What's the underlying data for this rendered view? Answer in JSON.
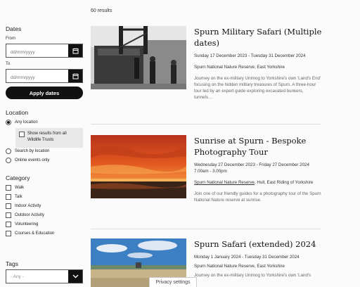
{
  "results_count": "60 results",
  "filters": {
    "dates": {
      "title": "Dates",
      "from_label": "From",
      "from_placeholder": "dd/mm/yyyy",
      "to_label": "To",
      "to_placeholder": "dd/mm/yyyy",
      "apply_label": "Apply dates"
    },
    "location": {
      "title": "Location",
      "options": [
        "Any location",
        "Search by location",
        "Online events only"
      ],
      "selected": "Any location",
      "show_all_label": "Show results from all Wildlife Trusts"
    },
    "category": {
      "title": "Category",
      "options": [
        "Walk",
        "Talk",
        "Indoor Activity",
        "Outdoor Activity",
        "Volunteering",
        "Courses & Education"
      ]
    },
    "tags": {
      "title": "Tags",
      "value": "- Any -"
    }
  },
  "results": [
    {
      "title": "Spurn Military Safari (Multiple dates)",
      "date": "Sunday 17 December 2023 - Tuesday 31 December 2024",
      "time": "",
      "location_link": "",
      "location": "Spurn National Nature Reserve, East Yorkshire",
      "description": "Journey on the ex-military Unimog to Yorkshire's own 'Land's End' focusing on the hidden military treasures of Spurn. A three-hour tour led by an expert guide exploring excavated bunkers, tunnels…"
    },
    {
      "title": "Sunrise at Spurn - Bespoke Photography Tour",
      "date": "Wednesday 27 December 2023 - Friday 27 December 2024",
      "time": "7.00am - 3.00pm",
      "location_link": "Spurn National Nature Reserve",
      "location": ", Hull, East Riding of Yorkshire",
      "description": "Join one of our friendly guides for a photography tour of the Spurn National Nature reserve at sunrise."
    },
    {
      "title": "Spurn Safari (extended) 2024",
      "date": "Monday 1 January 2024 - Tuesday 31 December 2024",
      "time": "",
      "location_link": "",
      "location": "Spurn National Nature Reserve, East Yorkshire",
      "description": "Journey on the ex-military Unimog to Yorkshire's own 'Land's"
    }
  ],
  "privacy_label": "Privacy settings",
  "colors": {
    "dark": "#111111",
    "sunrise": "#e2581f",
    "sky": "#3c7fc2"
  }
}
